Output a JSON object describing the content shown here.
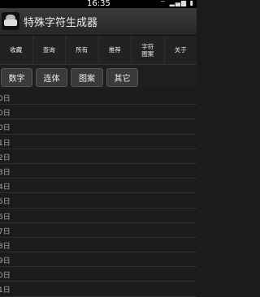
{
  "status_bar": {
    "time": "16:35",
    "icons": "⌔ ▂▄▆ ▮"
  },
  "app": {
    "title": "特殊字符生成器",
    "icon": "keyboard-cloud-icon"
  },
  "tabs": [
    {
      "label": "收藏"
    },
    {
      "label": "查询"
    },
    {
      "label": "所有"
    },
    {
      "label": "推荐"
    },
    {
      "label": "字符\n图案"
    },
    {
      "label": "关于"
    }
  ],
  "filters": [
    {
      "label": "数字"
    },
    {
      "label": "连体"
    },
    {
      "label": "图案"
    },
    {
      "label": "其它"
    }
  ],
  "list_items": [
    "0日",
    "0日",
    "0日",
    "1日",
    "2日",
    "3日",
    "4日",
    "5日",
    "6日",
    "7日",
    "8日",
    "9日",
    "0日",
    "1日"
  ]
}
